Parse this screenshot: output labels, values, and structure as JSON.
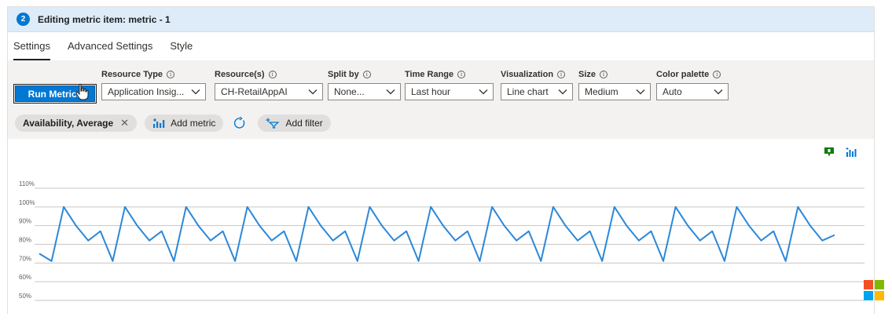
{
  "header": {
    "step": "2",
    "title": "Editing metric item: metric - 1"
  },
  "tabs": [
    {
      "label": "Settings",
      "active": true
    },
    {
      "label": "Advanced Settings",
      "active": false
    },
    {
      "label": "Style",
      "active": false
    }
  ],
  "toolbar": {
    "run_label": "Run Metrics",
    "fields": [
      {
        "label": "Resource Type",
        "value": "Application Insig..."
      },
      {
        "label": "Resource(s)",
        "value": "CH-RetailAppAI"
      },
      {
        "label": "Split by",
        "value": "None..."
      },
      {
        "label": "Time Range",
        "value": "Last hour"
      },
      {
        "label": "Visualization",
        "value": "Line chart"
      },
      {
        "label": "Size",
        "value": "Medium"
      },
      {
        "label": "Color palette",
        "value": "Auto"
      }
    ]
  },
  "chips": {
    "metric": "Availability, Average",
    "add_metric": "Add metric",
    "add_filter": "Add filter"
  },
  "colors": {
    "accent": "#0078d4",
    "line": "#2b88d8",
    "toolbar_bg": "#f3f2f1",
    "header_bg": "#deecf9"
  },
  "icons": [
    "info-icon",
    "chevron-down-icon",
    "close-icon",
    "add-metric-icon",
    "refresh-icon",
    "add-filter-icon",
    "pin-icon",
    "chart-icon"
  ],
  "chart_data": {
    "type": "line",
    "y_tick_labels": [
      "110%",
      "100%",
      "90%",
      "80%",
      "70%",
      "60%",
      "50%"
    ],
    "y_ticks": [
      110,
      100,
      90,
      80,
      70,
      60,
      50
    ],
    "ylim": [
      50,
      110
    ],
    "grid": true,
    "series": [
      {
        "values": [
          75,
          71,
          100,
          90,
          82,
          87,
          71,
          100,
          90,
          82,
          87,
          71,
          100,
          90,
          82,
          87,
          71,
          100,
          90,
          82,
          87,
          71,
          100,
          90,
          82,
          87,
          71,
          100,
          90,
          82,
          87,
          71,
          100,
          90,
          82,
          87,
          71,
          100,
          90,
          82,
          87,
          71,
          100,
          90,
          82,
          87,
          71,
          100,
          90,
          82,
          87,
          71,
          100,
          90,
          82,
          87,
          71,
          100,
          90,
          82,
          87,
          71,
          100,
          90,
          82,
          85
        ]
      }
    ]
  }
}
